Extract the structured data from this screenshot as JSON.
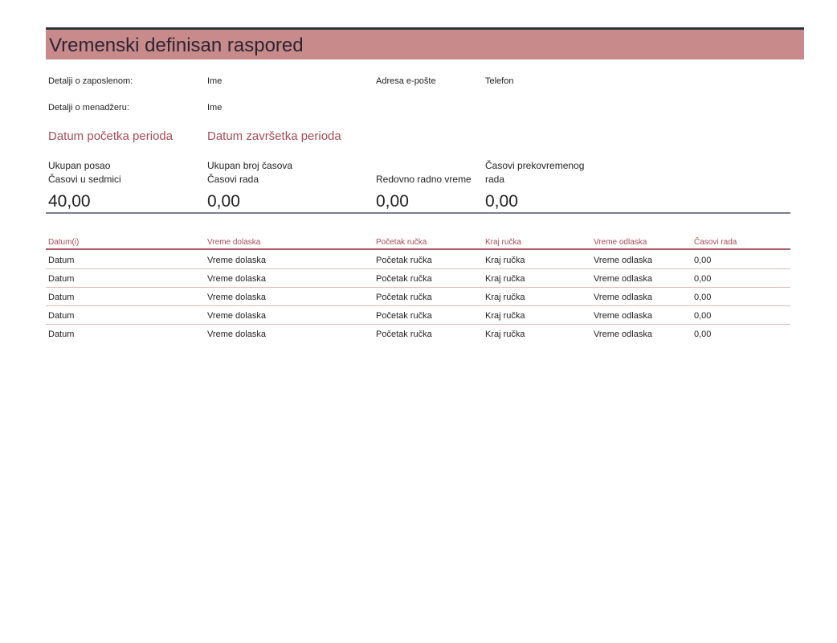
{
  "title": "Vremenski definisan raspored",
  "employee": {
    "label": "Detalji o zaposlenom:",
    "name": "Ime",
    "email_label": "Adresa e-pošte",
    "phone_label": "Telefon"
  },
  "manager": {
    "label": "Detalji o menadžeru:",
    "name": "Ime"
  },
  "period": {
    "start_label": "Datum početka perioda",
    "end_label": "Datum završetka perioda"
  },
  "summary": [
    {
      "label_line1": "Ukupan posao",
      "label_line2": "Časovi u sedmici",
      "value": "40,00"
    },
    {
      "label_line1": "Ukupan broj časova",
      "label_line2": "Časovi rada",
      "value": "0,00"
    },
    {
      "label_line1": "",
      "label_line2": "Redovno radno vreme",
      "value": "0,00"
    },
    {
      "label_line1": "Časovi prekovremenog",
      "label_line2": "rada",
      "value": "0,00"
    }
  ],
  "table": {
    "headers": [
      "Datum(i)",
      "Vreme dolaska",
      "Početak ručka",
      "Kraj ručka",
      "Vreme odlaska",
      "Časovi rada"
    ],
    "rows": [
      [
        "Datum",
        "Vreme dolaska",
        "Početak ručka",
        "Kraj ručka",
        "Vreme odlaska",
        "0,00"
      ],
      [
        "Datum",
        "Vreme dolaska",
        "Početak ručka",
        "Kraj ručka",
        "Vreme odlaska",
        "0,00"
      ],
      [
        "Datum",
        "Vreme dolaska",
        "Početak ručka",
        "Kraj ručka",
        "Vreme odlaska",
        "0,00"
      ],
      [
        "Datum",
        "Vreme dolaska",
        "Početak ručka",
        "Kraj ručka",
        "Vreme odlaska",
        "0,00"
      ],
      [
        "Datum",
        "Vreme dolaska",
        "Početak ručka",
        "Kraj ručka",
        "Vreme odlaska",
        "0,00"
      ]
    ]
  },
  "colors": {
    "title_bar": "#c98a8c",
    "accent_text": "#a84c55",
    "row_rule": "#e1b8bb"
  }
}
